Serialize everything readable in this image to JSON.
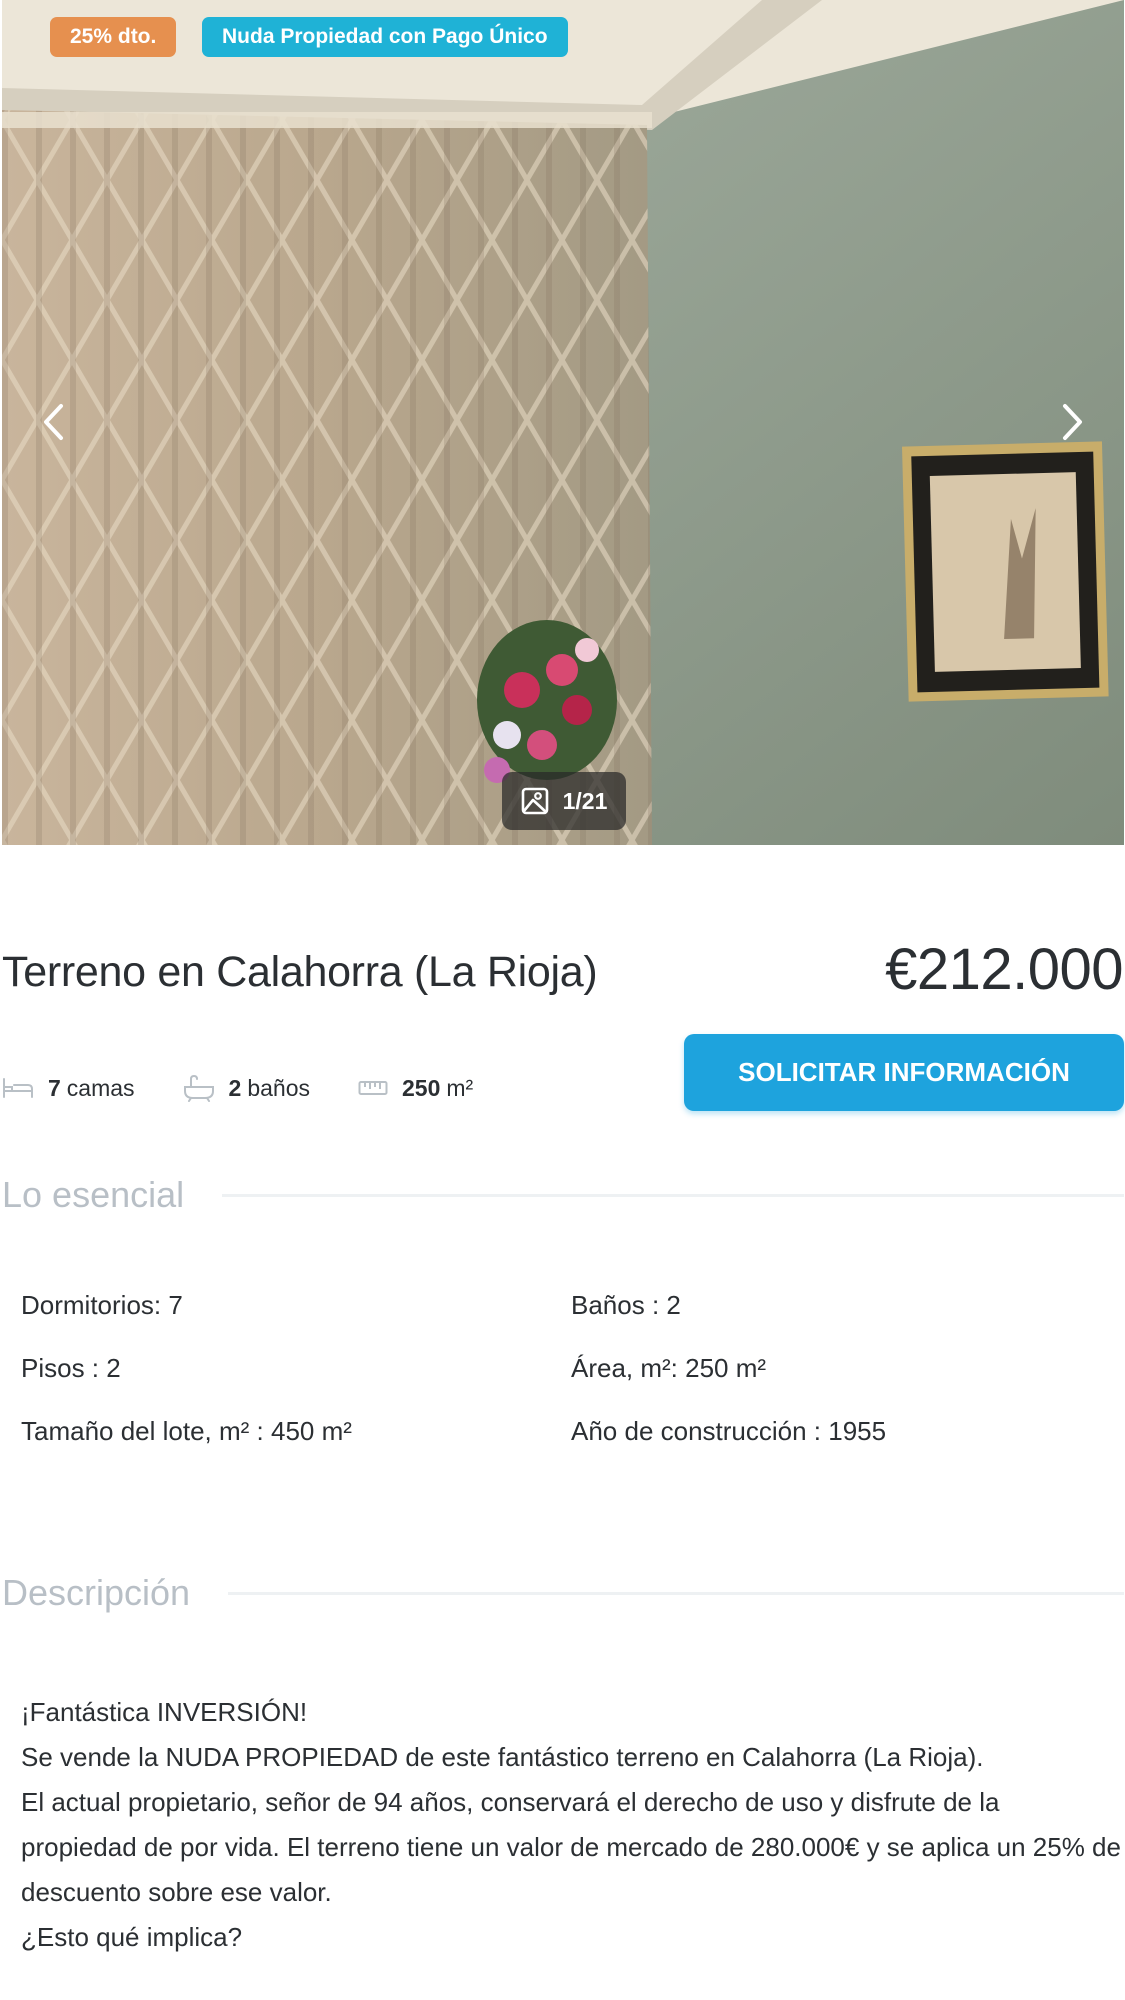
{
  "gallery": {
    "badges": {
      "discount": "25% dto.",
      "type": "Nuda Propiedad con Pago Único"
    },
    "counter": "1/21",
    "icons": {
      "prev": "chevron-left-icon",
      "next": "chevron-right-icon",
      "counter": "image-icon"
    }
  },
  "listing": {
    "title": "Terreno en Calahorra (La Rioja)",
    "price": "€212.000",
    "cta_label": "SOLICITAR INFORMACIÓN",
    "features": [
      {
        "icon": "bed-icon",
        "value": "7",
        "unit": "camas"
      },
      {
        "icon": "bathtub-icon",
        "value": "2",
        "unit": "baños"
      },
      {
        "icon": "ruler-icon",
        "value": "250",
        "unit": "m²"
      }
    ]
  },
  "essentials": {
    "heading": "Lo esencial",
    "rows": [
      [
        "Dormitorios: 7",
        "Baños : 2"
      ],
      [
        "Pisos : 2",
        "Área, m²: 250 m²"
      ],
      [
        "Tamaño del lote, m² : 450 m²",
        "Año de construcción : 1955"
      ]
    ]
  },
  "description": {
    "heading": "Descripción",
    "paragraphs": [
      "¡Fantástica INVERSIÓN!",
      "Se vende la NUDA PROPIEDAD de este fantástico terreno en Calahorra (La Rioja).",
      "El actual propietario, señor de 94 años, conservará el derecho de uso y disfrute de la propiedad de por vida. El terreno tiene un valor de mercado de 280.000€ y se aplica un 25% de descuento sobre ese valor.",
      "¿Esto qué implica?"
    ]
  },
  "colors": {
    "discount_badge": "#e6904f",
    "type_badge": "#1fb2d6",
    "cta": "#1ea3dd",
    "text": "#2b2f33",
    "section_heading": "#b8bfc6"
  }
}
